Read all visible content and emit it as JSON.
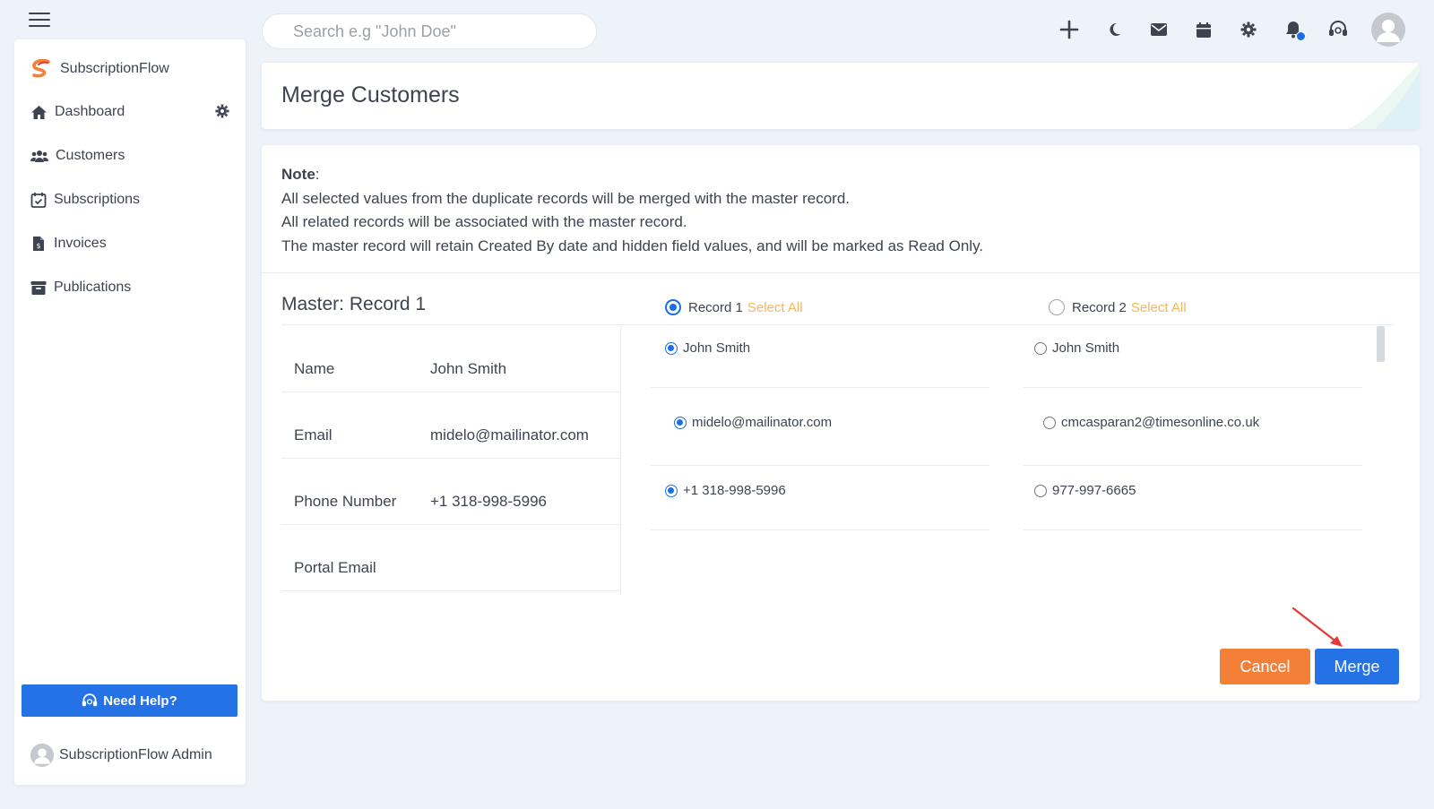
{
  "search": {
    "placeholder": "Search e.g \"John Doe\""
  },
  "sidebar": {
    "brand": "SubscriptionFlow",
    "items": [
      {
        "label": "Dashboard",
        "icon": "home-icon"
      },
      {
        "label": "Customers",
        "icon": "users-icon"
      },
      {
        "label": "Subscriptions",
        "icon": "calendar-check-icon"
      },
      {
        "label": "Invoices",
        "icon": "invoice-icon"
      },
      {
        "label": "Publications",
        "icon": "archive-icon"
      }
    ],
    "help_label": "Need Help?",
    "admin_name": "SubscriptionFlow Admin"
  },
  "header": {
    "title": "Merge Customers"
  },
  "note": {
    "label": "Note",
    "lines": [
      "All selected values from the duplicate records will be merged with the master record.",
      "All related records will be associated with the master record.",
      "The master record will retain Created By date and hidden field values, and will be marked as Read Only."
    ]
  },
  "master": {
    "title": "Master: Record 1",
    "fields": [
      {
        "label": "Name",
        "value": "John Smith"
      },
      {
        "label": "Email",
        "value": "midelo@mailinator.com"
      },
      {
        "label": "Phone Number",
        "value": "+1 318-998-5996"
      },
      {
        "label": "Portal Email",
        "value": ""
      }
    ]
  },
  "records": [
    {
      "label": "Record 1",
      "select_all": "Select All",
      "selected": true,
      "values": [
        "John Smith",
        "midelo@mailinator.com",
        "+1 318-998-5996"
      ]
    },
    {
      "label": "Record 2",
      "select_all": "Select All",
      "selected": false,
      "values": [
        "John Smith",
        "cmcasparan2@timesonline.co.uk",
        "977-997-6665"
      ]
    }
  ],
  "actions": {
    "cancel": "Cancel",
    "merge": "Merge"
  },
  "colors": {
    "primary": "#2472e6",
    "cancel": "#f47f36",
    "select_all": "#f6b55a",
    "annotation_arrow": "#e53935"
  }
}
